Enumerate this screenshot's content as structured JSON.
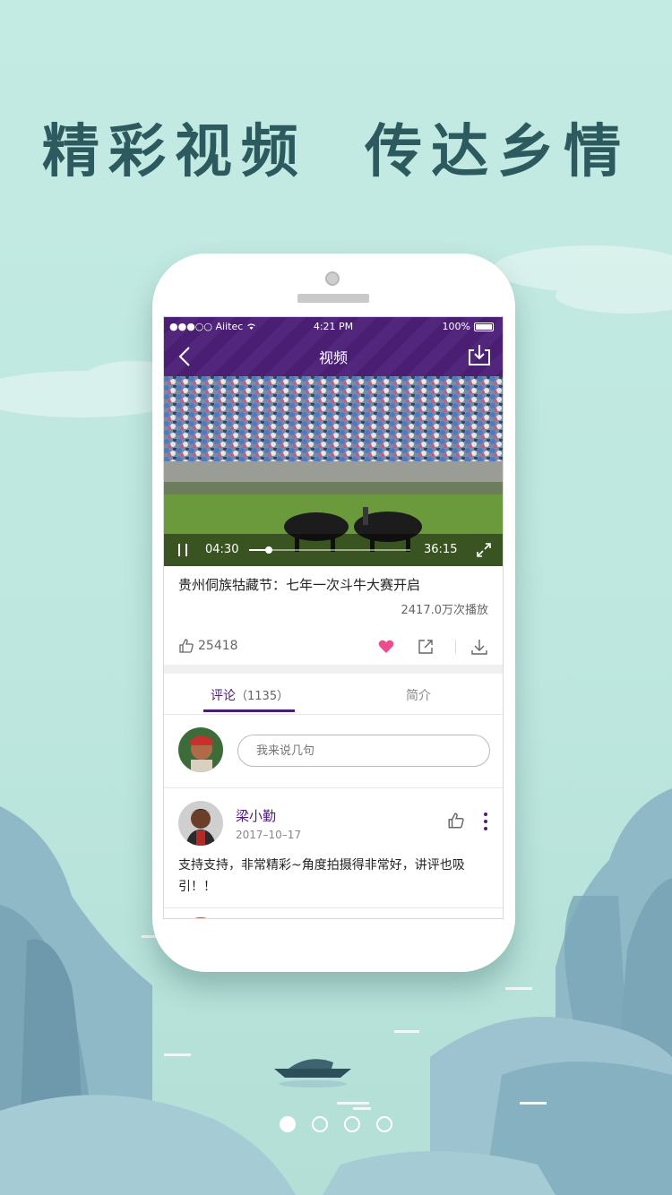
{
  "headline": {
    "part1": "精彩视频",
    "part2": "传达乡情"
  },
  "status_bar": {
    "carrier": "●●●○○ Aiitec",
    "time": "4:21 PM",
    "battery": "100%"
  },
  "nav": {
    "title": "视频"
  },
  "player": {
    "current_time": "04:30",
    "total_time": "36:15",
    "progress_fraction": 0.124
  },
  "video": {
    "title": "贵州侗族牯藏节：七年一次斗牛大赛开启",
    "play_count": "2417.0万次播放",
    "likes": "25418"
  },
  "tabs": {
    "comments_label": "评论",
    "comments_count": "（1135）",
    "intro_label": "简介"
  },
  "composer": {
    "placeholder": "我来说几句"
  },
  "comments": [
    {
      "author": "梁小勤",
      "date": "2017–10–17",
      "text": "支持支持，非常精彩~角度拍摄得非常好，讲评也吸引！！"
    }
  ],
  "colors": {
    "brand": "#4a1f73",
    "heart": "#ee4d8c",
    "background": "#c4ebe3"
  },
  "icons": [
    "back-arrow-icon",
    "download-icon",
    "pause-icon",
    "fullscreen-icon",
    "thumbs-up-icon",
    "heart-icon",
    "share-icon",
    "more-icon",
    "wifi-icon",
    "battery-icon"
  ],
  "pager": {
    "count": 4,
    "active_index": 0
  }
}
